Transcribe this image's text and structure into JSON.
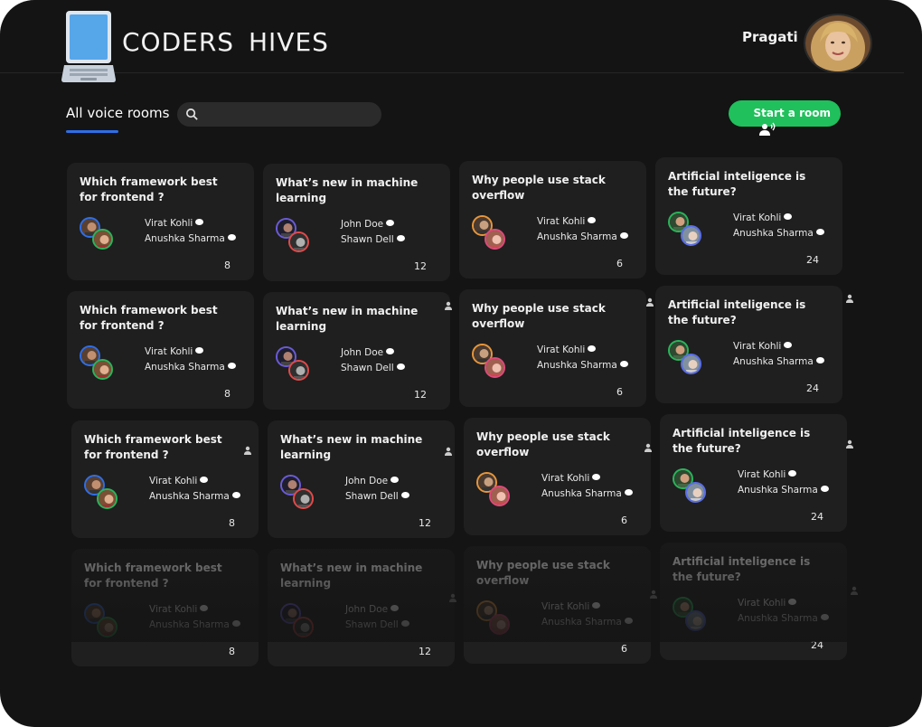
{
  "brand": {
    "title": "CODERS  HIVES"
  },
  "user": {
    "name": "Pragati"
  },
  "toolbar": {
    "tab_label": "All voice rooms",
    "search_placeholder": "",
    "start_button_label": "Start a room"
  },
  "colors": {
    "accent_blue": "#2f6ee8",
    "start_green": "#20c05c",
    "card_bg": "#1f1f1f",
    "background": "#141414"
  },
  "rooms": [
    {
      "title": "Which framework best for frontend ?",
      "speakers": [
        "Virat Kohli",
        "Anushka Sharma"
      ],
      "listeners": "8"
    },
    {
      "title": "What’s new in machine learning",
      "speakers": [
        "John Doe",
        "Shawn  Dell"
      ],
      "listeners": "12"
    },
    {
      "title": "Why people use stack overflow",
      "speakers": [
        "Virat Kohli",
        "Anushka Sharma"
      ],
      "listeners": "6"
    },
    {
      "title": "Artificial inteligence is the future?",
      "speakers": [
        "Virat Kohli",
        "Anushka Sharma"
      ],
      "listeners": "24"
    }
  ]
}
